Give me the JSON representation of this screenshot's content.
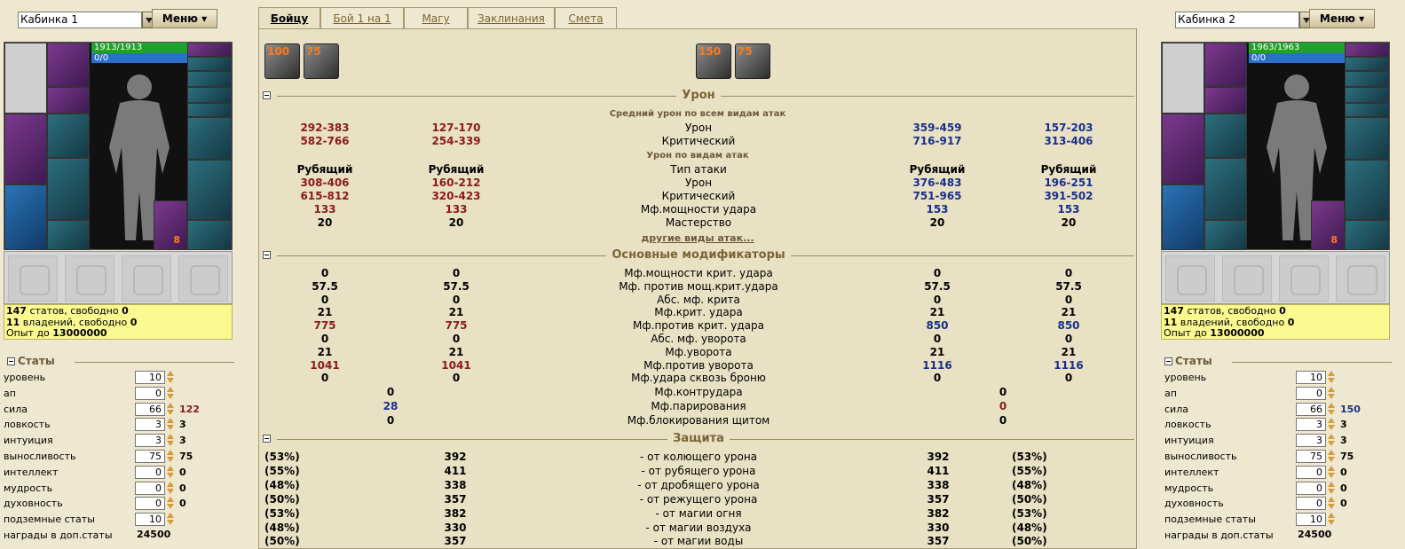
{
  "left": {
    "cabin": "Кабинка 1",
    "menu": "Меню",
    "hp": "1913/1913",
    "mp": "0/0",
    "ring_count": "8",
    "stats_line": {
      "a": "147",
      "b": " статов, свободно ",
      "c": "0"
    },
    "skills_line": {
      "a": "11",
      "b": " владений, свободно ",
      "c": "0"
    },
    "exp_line": {
      "a": "Опыт до ",
      "b": "13000000"
    },
    "stats_title": "Статы",
    "rows": [
      {
        "label": "уровень",
        "value": "10",
        "total": ""
      },
      {
        "label": "ап",
        "value": "0",
        "total": ""
      },
      {
        "label": "сила",
        "value": "66",
        "total": "122"
      },
      {
        "label": "ловкость",
        "value": "3",
        "total": "3"
      },
      {
        "label": "интуиция",
        "value": "3",
        "total": "3"
      },
      {
        "label": "выносливость",
        "value": "75",
        "total": "75"
      },
      {
        "label": "интеллект",
        "value": "0",
        "total": "0"
      },
      {
        "label": "мудрость",
        "value": "0",
        "total": "0"
      },
      {
        "label": "духовность",
        "value": "0",
        "total": "0"
      },
      {
        "label": "подземные статы",
        "value": "10",
        "total": ""
      },
      {
        "label": "награды в доп.статы",
        "value": "24500",
        "total": ""
      }
    ]
  },
  "right": {
    "cabin": "Кабинка 2",
    "menu": "Меню",
    "hp": "1963/1963",
    "mp": "0/0",
    "ring_count": "8",
    "stats_line": {
      "a": "147",
      "b": " статов, свободно ",
      "c": "0"
    },
    "skills_line": {
      "a": "11",
      "b": " владений, свободно ",
      "c": "0"
    },
    "exp_line": {
      "a": "Опыт до ",
      "b": "13000000"
    },
    "stats_title": "Статы",
    "rows": [
      {
        "label": "уровень",
        "value": "10",
        "total": ""
      },
      {
        "label": "ап",
        "value": "0",
        "total": ""
      },
      {
        "label": "сила",
        "value": "66",
        "total": "150"
      },
      {
        "label": "ловкость",
        "value": "3",
        "total": "3"
      },
      {
        "label": "интуиция",
        "value": "3",
        "total": "3"
      },
      {
        "label": "выносливость",
        "value": "75",
        "total": "75"
      },
      {
        "label": "интеллект",
        "value": "0",
        "total": "0"
      },
      {
        "label": "мудрость",
        "value": "0",
        "total": "0"
      },
      {
        "label": "духовность",
        "value": "0",
        "total": "0"
      },
      {
        "label": "подземные статы",
        "value": "10",
        "total": ""
      },
      {
        "label": "награды в доп.статы",
        "value": "24500",
        "total": ""
      }
    ]
  },
  "tabs": [
    "Бойцу",
    "Бой 1 на 1",
    "Магу",
    "Заклинания",
    "Смета"
  ],
  "skills_left": [
    "100",
    "75"
  ],
  "skills_right": [
    "150",
    "75"
  ],
  "sections": {
    "damage": "Урон",
    "modifiers": "Основные модификаторы",
    "defense": "Защита"
  },
  "avg_title": "Средний урон по всем видам атак",
  "by_type_title": "Урон по видам атак",
  "other_link": "другие виды атак...",
  "avg_rows": [
    {
      "c1": "292-383",
      "c2": "127-170",
      "m": "Урон",
      "c3": "359-459",
      "c4": "157-203"
    },
    {
      "c1": "582-766",
      "c2": "254-339",
      "m": "Критический",
      "c3": "716-917",
      "c4": "313-406"
    }
  ],
  "type_rows": [
    {
      "c1": "Рубящий",
      "c2": "Рубящий",
      "m": "Тип атаки",
      "c3": "Рубящий",
      "c4": "Рубящий",
      "style": "k"
    },
    {
      "c1": "308-406",
      "c2": "160-212",
      "m": "Урон",
      "c3": "376-483",
      "c4": "196-251",
      "style": "c"
    },
    {
      "c1": "615-812",
      "c2": "320-423",
      "m": "Критический",
      "c3": "751-965",
      "c4": "391-502",
      "style": "c"
    },
    {
      "c1": "133",
      "c2": "133",
      "m": "Мф.мощности удара",
      "c3": "153",
      "c4": "153",
      "style": "c"
    },
    {
      "c1": "20",
      "c2": "20",
      "m": "Мастерство",
      "c3": "20",
      "c4": "20",
      "style": "k"
    }
  ],
  "mod_rows": [
    {
      "c1": "0",
      "c2": "0",
      "m": "Мф.мощности крит. удара",
      "c3": "0",
      "c4": "0",
      "style": "k"
    },
    {
      "c1": "57.5",
      "c2": "57.5",
      "m": "Мф. против мощ.крит.удара",
      "c3": "57.5",
      "c4": "57.5",
      "style": "k"
    },
    {
      "c1": "0",
      "c2": "0",
      "m": "Абс. мф. крита",
      "c3": "0",
      "c4": "0",
      "style": "k"
    },
    {
      "c1": "21",
      "c2": "21",
      "m": "Мф.крит. удара",
      "c3": "21",
      "c4": "21",
      "style": "k"
    },
    {
      "c1": "775",
      "c2": "775",
      "m": "Мф.против крит. удара",
      "c3": "850",
      "c4": "850",
      "style": "c"
    },
    {
      "c1": "0",
      "c2": "0",
      "m": "Абс. мф. уворота",
      "c3": "0",
      "c4": "0",
      "style": "k"
    },
    {
      "c1": "21",
      "c2": "21",
      "m": "Мф.уворота",
      "c3": "21",
      "c4": "21",
      "style": "k"
    },
    {
      "c1": "1041",
      "c2": "1041",
      "m": "Мф.против уворота",
      "c3": "1116",
      "c4": "1116",
      "style": "c"
    },
    {
      "c1": "0",
      "c2": "0",
      "m": "Мф.удара сквозь броню",
      "c3": "0",
      "c4": "0",
      "style": "k"
    }
  ],
  "mod_rows2": [
    {
      "l": "0",
      "m": "Мф.контрудара",
      "r": "0",
      "ls": "k",
      "rs": "k"
    },
    {
      "l": "28",
      "m": "Мф.парирования",
      "r": "0",
      "ls": "b",
      "rs": "r"
    },
    {
      "l": "0",
      "m": "Мф.блокирования щитом",
      "r": "0",
      "ls": "k",
      "rs": "k"
    }
  ],
  "def_rows": [
    {
      "p1": "(53%)",
      "v1": "392",
      "m": "- от колющего урона",
      "v2": "392",
      "p2": "(53%)"
    },
    {
      "p1": "(55%)",
      "v1": "411",
      "m": "- от рубящего урона",
      "v2": "411",
      "p2": "(55%)"
    },
    {
      "p1": "(48%)",
      "v1": "338",
      "m": "- от дробящего урона",
      "v2": "338",
      "p2": "(48%)"
    },
    {
      "p1": "(50%)",
      "v1": "357",
      "m": "- от режущего урона",
      "v2": "357",
      "p2": "(50%)"
    },
    {
      "p1": "(53%)",
      "v1": "382",
      "m": "- от магии огня",
      "v2": "382",
      "p2": "(53%)"
    },
    {
      "p1": "(48%)",
      "v1": "330",
      "m": "- от магии воздуха",
      "v2": "330",
      "p2": "(48%)"
    },
    {
      "p1": "(50%)",
      "v1": "357",
      "m": "- от магии воды",
      "v2": "357",
      "p2": "(50%)"
    }
  ]
}
